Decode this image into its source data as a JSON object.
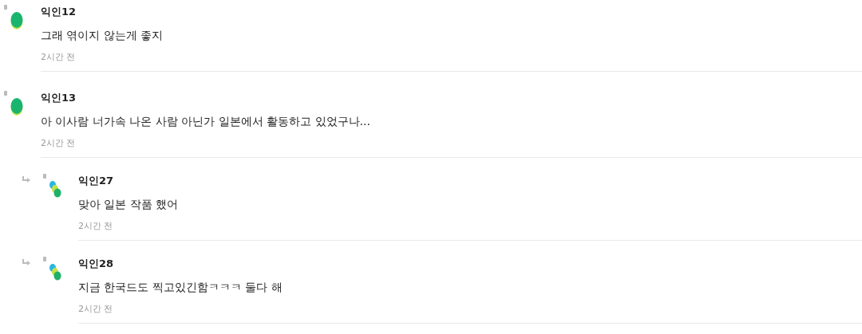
{
  "comments": [
    {
      "kind": "comment",
      "author": "익인12",
      "text": "그래 엮이지 않는게 좋지",
      "time": "2시간 전"
    },
    {
      "kind": "comment",
      "author": "익인13",
      "text": "아 이사람 너가속 나온 사람 아닌가 일본에서 활동하고 있었구나...",
      "time": "2시간 전"
    },
    {
      "kind": "reply",
      "author": "익인27",
      "text": "맞아 일본 작품 했어",
      "time": "2시간 전"
    },
    {
      "kind": "reply",
      "author": "익인28",
      "text": "지금 한국드도 찍고있긴함ㅋㅋㅋ 둘다 해",
      "time": "2시간 전"
    }
  ]
}
